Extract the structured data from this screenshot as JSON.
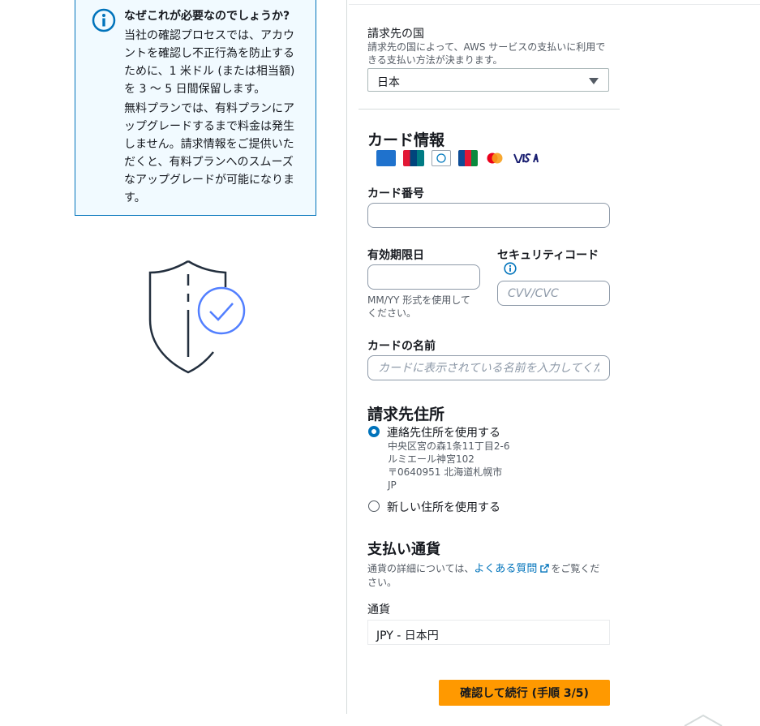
{
  "info": {
    "title": "なぜこれが必要なのでしょうか?",
    "para1": [
      "当社の確認プロセスでは、アカウ",
      "ントを確認し不正行為を防止する",
      "ために、1 米ドル (または相当額)",
      "を 3 ～ 5 日間保留します。"
    ],
    "para2": [
      "無料プランでは、有料プランにア",
      "ップグレードするまで料金は発生",
      "しません。請求情報をご提供いた",
      "だくと、有料プランへのスムーズ",
      "なアップグレードが可能になりま",
      "す。"
    ]
  },
  "billing_country": {
    "label": "請求先の国",
    "desc": [
      "請求先の国によって、AWS サービスの支払いに利用で",
      "きる支払い方法が決まります。"
    ],
    "value": "日本"
  },
  "card_info": {
    "heading": "カード情報",
    "brands": [
      "AMEX",
      "UnionPay",
      "Diners Club",
      "JCB",
      "Mastercard",
      "VISA"
    ],
    "number_label": "カード番号",
    "expiry_label": "有効期限日",
    "expiry_hint": [
      "MM/YY 形式を使用して",
      "ください。"
    ],
    "cvv_label": "セキュリティコード",
    "cvv_placeholder": "CVV/CVC",
    "name_label": "カードの名前",
    "name_placeholder": "カードに表示されている名前を入力してください"
  },
  "billing_address": {
    "heading": "請求先住所",
    "option_contact": "連絡先住所を使用する",
    "address_lines": [
      "中央区宮の森1条11丁目2-6",
      "ルミエール神宮102",
      "〒0640951 北海道札幌市",
      "JP"
    ],
    "option_new": "新しい住所を使用する"
  },
  "currency": {
    "heading": "支払い通貨",
    "desc_before": "通貨の詳細については、",
    "link": "よくある質問",
    "desc_after_1": "をご覧くだ",
    "desc_after_2": "さい。",
    "label": "通貨",
    "value": "JPY - 日本円"
  },
  "continue_button": "確認して続行 (手順 3/5)",
  "colors": {
    "accent": "#0073bb",
    "button": "#ff9900",
    "info_bg": "#f1faff"
  }
}
